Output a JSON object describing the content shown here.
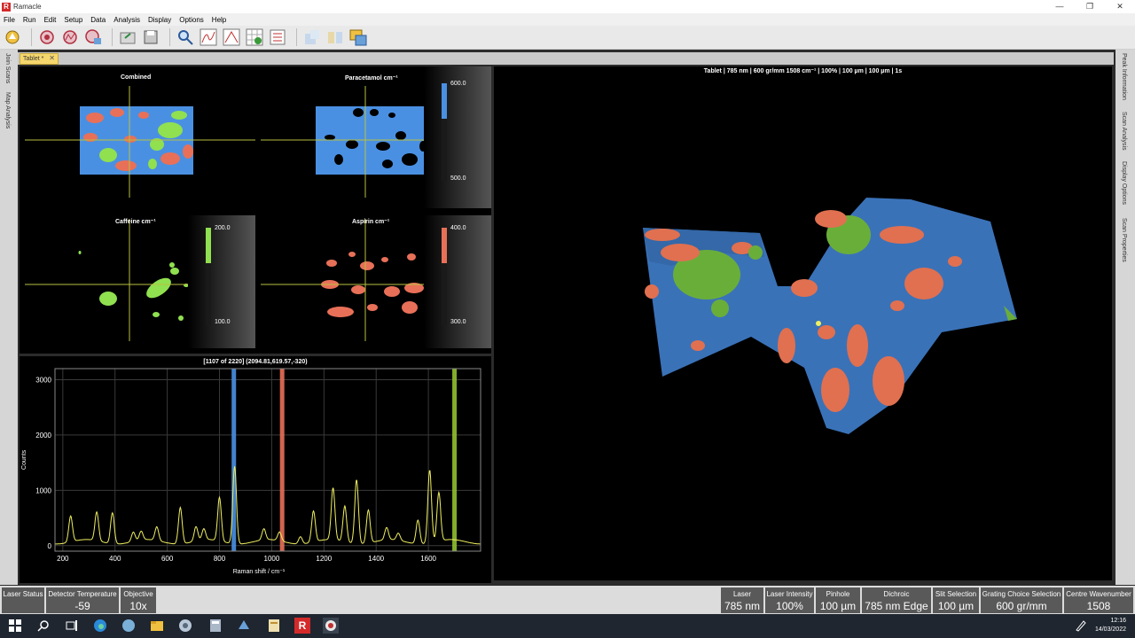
{
  "window": {
    "title": "Ramacle",
    "logo_letter": "R"
  },
  "menu": [
    "File",
    "Run",
    "Edit",
    "Setup",
    "Data",
    "Analysis",
    "Display",
    "Options",
    "Help"
  ],
  "toolbar_icons": [
    "acquire-icon",
    "laser-icon",
    "spectrum-icon",
    "map-icon",
    "open-icon",
    "save-icon",
    "zoom-icon",
    "peak-fit-icon",
    "baseline-icon",
    "grid-check-icon",
    "checklist-icon",
    "export-icon",
    "layers-icon",
    "window-icon"
  ],
  "tab": {
    "label": "Tablet *",
    "close": "✕"
  },
  "left_strip": [
    "Join Scans",
    "Map Analysis"
  ],
  "right_strip": [
    "Peak Information",
    "Scan Analysis",
    "Display Options",
    "Scan Properties"
  ],
  "maps": {
    "combined": {
      "title": "Combined"
    },
    "paracetamol": {
      "title": "Paracetamol cm⁻¹",
      "max": "600.0",
      "min": "500.0",
      "color": "#4a90e2"
    },
    "caffeine": {
      "title": "Caffeine cm⁻¹",
      "max": "200.0",
      "min": "100.0",
      "color": "#90e050"
    },
    "aspirin": {
      "title": "Aspirin cm⁻¹",
      "max": "400.0",
      "min": "300.0",
      "color": "#e87058"
    }
  },
  "view3d": {
    "title": "Tablet | 785 nm | 600 gr/mm 1508 cm⁻¹ | 100% | 100 µm | 100 µm | 1s"
  },
  "chart_data": {
    "type": "line",
    "title": "[1107 of 2220] (2094.81,619.57,-320)",
    "xlabel": "Raman shift / cm⁻¹",
    "ylabel": "Counts",
    "xlim": [
      170,
      1800
    ],
    "ylim": [
      -100,
      3200
    ],
    "xticks": [
      200,
      400,
      600,
      800,
      1000,
      1200,
      1400,
      1600
    ],
    "yticks": [
      0,
      1000,
      2000,
      3000
    ],
    "grid": true,
    "markers": [
      {
        "x": 855,
        "color": "#4a90e2"
      },
      {
        "x": 1040,
        "color": "#e87058"
      },
      {
        "x": 1700,
        "color": "#90c030"
      }
    ],
    "peaks": [
      {
        "x": 230,
        "y": 470
      },
      {
        "x": 330,
        "y": 520
      },
      {
        "x": 390,
        "y": 560
      },
      {
        "x": 470,
        "y": 170
      },
      {
        "x": 500,
        "y": 160
      },
      {
        "x": 560,
        "y": 250
      },
      {
        "x": 650,
        "y": 660
      },
      {
        "x": 710,
        "y": 260
      },
      {
        "x": 740,
        "y": 200
      },
      {
        "x": 800,
        "y": 790
      },
      {
        "x": 858,
        "y": 1400
      },
      {
        "x": 970,
        "y": 200
      },
      {
        "x": 1030,
        "y": 160
      },
      {
        "x": 1110,
        "y": 130
      },
      {
        "x": 1160,
        "y": 560
      },
      {
        "x": 1235,
        "y": 940
      },
      {
        "x": 1280,
        "y": 650
      },
      {
        "x": 1325,
        "y": 1160
      },
      {
        "x": 1370,
        "y": 600
      },
      {
        "x": 1440,
        "y": 220
      },
      {
        "x": 1485,
        "y": 130
      },
      {
        "x": 1560,
        "y": 430
      },
      {
        "x": 1605,
        "y": 1320
      },
      {
        "x": 1640,
        "y": 880
      }
    ]
  },
  "status": {
    "left": [
      {
        "label": "Laser Status",
        "value": ""
      },
      {
        "label": "Detector Temperature",
        "value": "-59"
      },
      {
        "label": "Objective",
        "value": "10x"
      }
    ],
    "right": [
      {
        "label": "Laser",
        "value": "785 nm"
      },
      {
        "label": "Laser Intensity",
        "value": "100%"
      },
      {
        "label": "Pinhole",
        "value": "100 µm"
      },
      {
        "label": "Dichroic",
        "value": "785 nm Edge"
      },
      {
        "label": "Slit Selection",
        "value": "100 µm"
      },
      {
        "label": "Grating Choice Selection",
        "value": "600 gr/mm"
      },
      {
        "label": "Centre Wavenumber",
        "value": "1508"
      }
    ]
  },
  "taskbar": {
    "time": "12:16",
    "date": "14/03/2022",
    "ramacle_letter": "R"
  }
}
